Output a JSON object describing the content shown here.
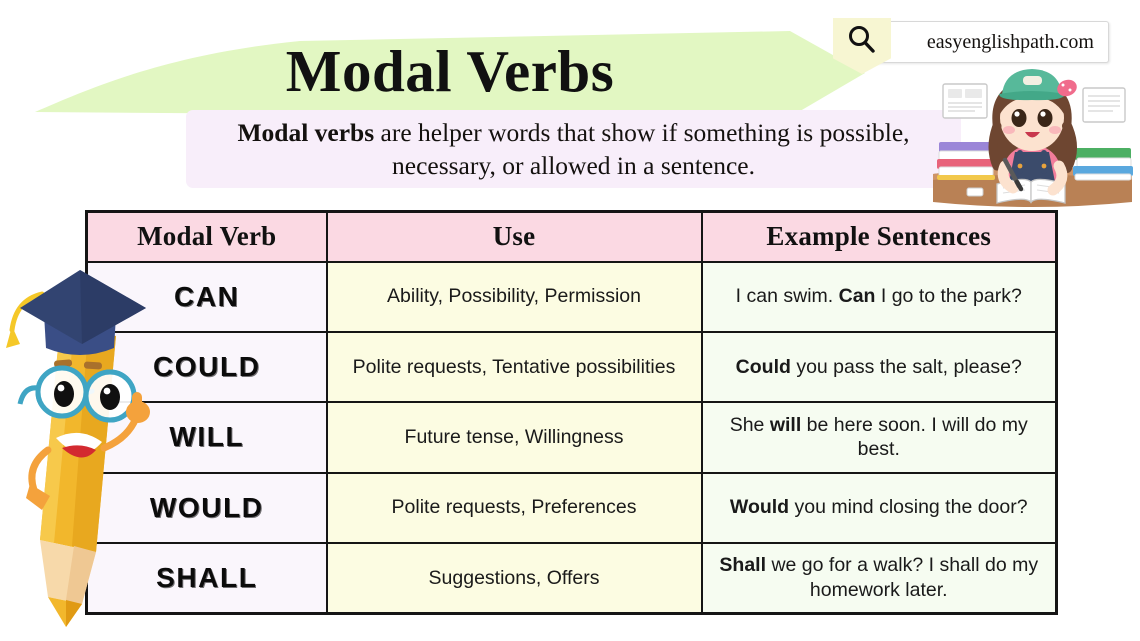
{
  "header": {
    "title": "Modal Verbs",
    "banner_color": "#E2F7C2",
    "subtitle_bold": "Modal verbs",
    "subtitle_rest": " are helper words that show if something is possible, necessary, or allowed in a sentence.",
    "subtitle_box_color": "#F8EEFA"
  },
  "brand": {
    "text": "easyenglishpath.com",
    "badge_color": "#F7F6D2",
    "icon": "search-icon"
  },
  "table": {
    "columns": [
      "Modal Verb",
      "Use",
      "Example Sentences"
    ],
    "header_color": "#FBD9E3",
    "col_colors": [
      "#FAF6FC",
      "#FCFCE2",
      "#F6FCF1"
    ],
    "rows": [
      {
        "verb": "CAN",
        "use": "Ability, Possibility, Permission",
        "example_pre": "I can swim. ",
        "example_bold": "Can",
        "example_post": " I go to the park?"
      },
      {
        "verb": "COULD",
        "use": "Polite requests, Tentative possibilities",
        "example_pre": "",
        "example_bold": "Could",
        "example_post": " you pass the salt, please?"
      },
      {
        "verb": "WILL",
        "use": "Future tense, Willingness",
        "example_pre": "She ",
        "example_bold": "will",
        "example_post": " be here soon. I will do my best."
      },
      {
        "verb": "WOULD",
        "use": "Polite requests, Preferences",
        "example_pre": "",
        "example_bold": "Would",
        "example_post": " you mind closing the door?"
      },
      {
        "verb": "SHALL",
        "use": "Suggestions, Offers",
        "example_pre": "",
        "example_bold": "Shall",
        "example_post": " we go for a walk? I shall do my homework later."
      }
    ]
  },
  "illustrations": {
    "pencil_mascot": "graduate-pencil-mascot",
    "girl_student": "girl-studying-illustration"
  }
}
